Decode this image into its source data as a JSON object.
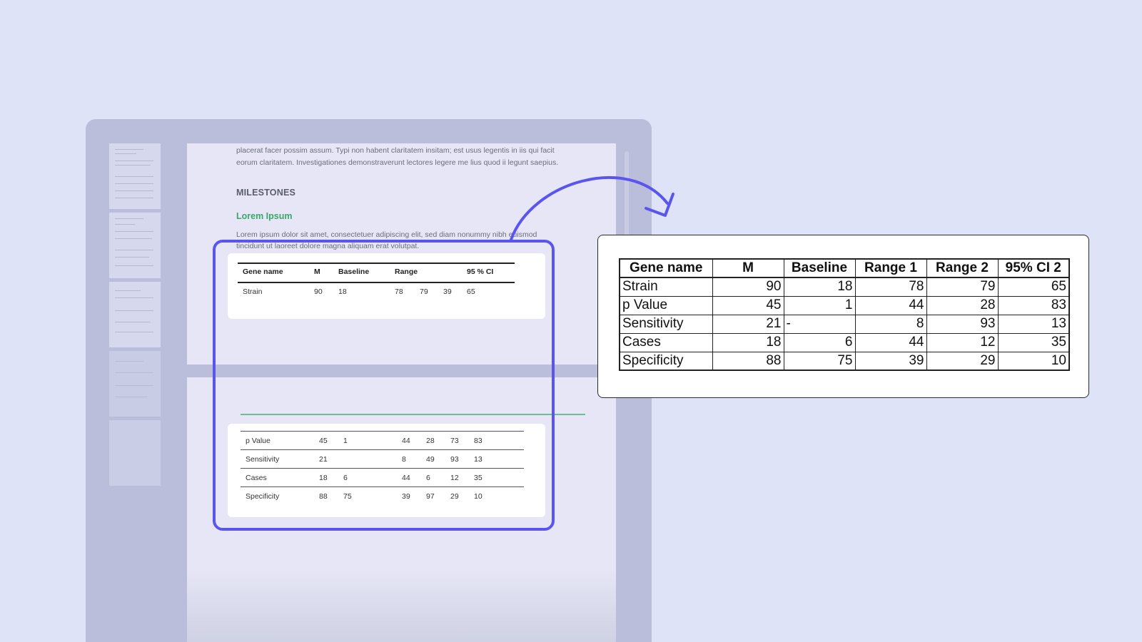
{
  "document": {
    "intro_line1": "placerat facer possim assum. Typi non habent claritatem insitam; est usus legentis in iis qui facit",
    "intro_line2": "eorum claritatem. Investigationes demonstraverunt lectores legere me lius quod ii legunt saepius.",
    "section_heading": "MILESTONES",
    "subheading": "Lorem Ipsum",
    "body_line1": "Lorem ipsum dolor sit amet, consectetuer adipiscing elit, sed diam nonummy nibh euismod",
    "body_line2": "tincidunt ut laoreet dolore magna aliquam erat volutpat."
  },
  "source_table": {
    "headers": [
      "Gene name",
      "M",
      "Baseline",
      "Range",
      "95 % CI"
    ],
    "page1_rows": [
      [
        "Strain",
        "90",
        "18",
        "78",
        "79",
        "39",
        "65"
      ]
    ],
    "page2_rows": [
      [
        "p Value",
        "45",
        "1",
        "44",
        "28",
        "73",
        "83"
      ],
      [
        "Sensitivity",
        "21",
        "",
        "8",
        "49",
        "93",
        "13"
      ],
      [
        "Cases",
        "18",
        "6",
        "44",
        "6",
        "12",
        "35"
      ],
      [
        "Specificity",
        "88",
        "75",
        "39",
        "97",
        "29",
        "10"
      ]
    ]
  },
  "extracted_table": {
    "headers": [
      "Gene name",
      "M",
      "Baseline",
      "Range 1",
      "Range 2",
      "95% CI 2"
    ],
    "rows": [
      [
        "Strain",
        "90",
        "18",
        "78",
        "79",
        "65"
      ],
      [
        "p Value",
        "45",
        "1",
        "44",
        "28",
        "83"
      ],
      [
        "Sensitivity",
        "21",
        "-",
        "8",
        "93",
        "13"
      ],
      [
        "Cases",
        "18",
        "6",
        "44",
        "12",
        "35"
      ],
      [
        "Specificity",
        "88",
        "75",
        "39",
        "29",
        "10"
      ]
    ]
  },
  "colors": {
    "background": "#dfe3f7",
    "selection": "#5b55f0",
    "accent_green": "#3aa86a"
  }
}
